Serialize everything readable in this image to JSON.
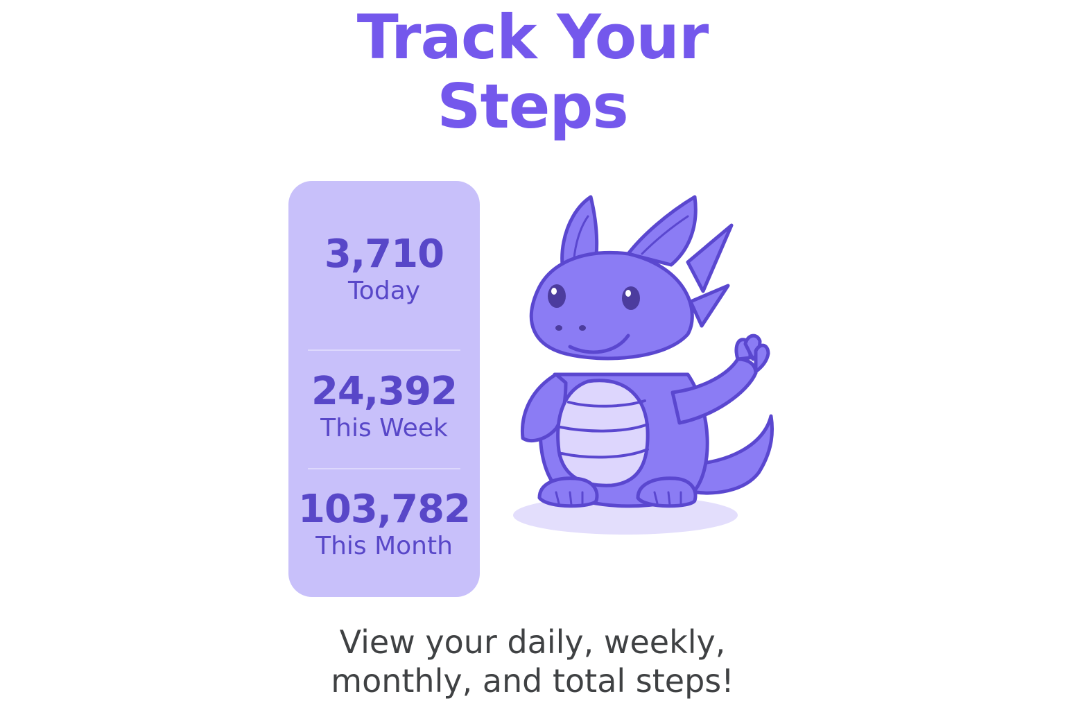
{
  "header": {
    "title_line1": "Track Your",
    "title_line2": "Steps"
  },
  "stats": [
    {
      "value": "3,710",
      "label": "Today"
    },
    {
      "value": "24,392",
      "label": "This Week"
    },
    {
      "value": "103,782",
      "label": "This Month"
    }
  ],
  "mascot": {
    "icon": "dragon-mascot",
    "colors": {
      "body": "#8b7cf4",
      "outline": "#5a47cf",
      "belly": "#ddd6fd",
      "shadow": "#e3defc"
    }
  },
  "caption": {
    "line1": "View your daily, weekly,",
    "line2": "monthly, and total steps!"
  },
  "colors": {
    "title": "#7458ec",
    "card": "#c8c0fa",
    "stat_text": "#5847c8",
    "caption": "#3f4143"
  }
}
